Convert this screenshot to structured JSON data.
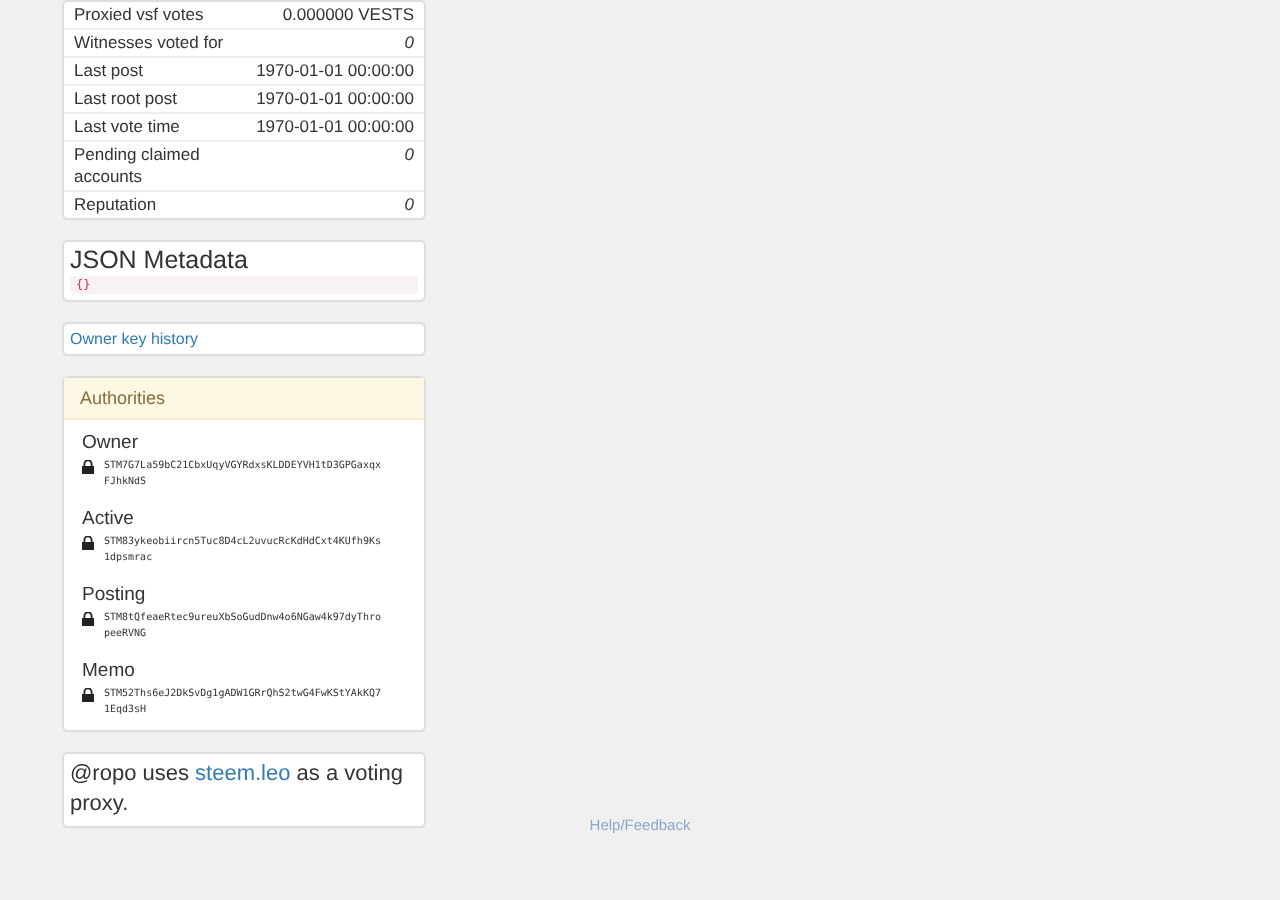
{
  "stats": [
    {
      "label": "Proxied vsf votes",
      "value": "0.000000 VESTS",
      "italic": false
    },
    {
      "label": "Witnesses voted for",
      "value": "0",
      "italic": true
    },
    {
      "label": "Last post",
      "value": "1970-01-01 00:00:00",
      "italic": false
    },
    {
      "label": "Last root post",
      "value": "1970-01-01 00:00:00",
      "italic": false
    },
    {
      "label": "Last vote time",
      "value": "1970-01-01 00:00:00",
      "italic": false
    },
    {
      "label": "Pending claimed accounts",
      "value": "0",
      "italic": true
    },
    {
      "label": "Reputation",
      "value": "0",
      "italic": true
    }
  ],
  "json_metadata": {
    "title": "JSON Metadata",
    "value": "{}"
  },
  "owner_key_history": {
    "label": "Owner key history"
  },
  "authorities": {
    "title": "Authorities",
    "roles": [
      {
        "name": "Owner",
        "key": "STM7G7La59bC21CbxUqyVGYRdxsKLDDEYVH1tD3GPGaxqxFJhkNdS"
      },
      {
        "name": "Active",
        "key": "STM83ykeobiircn5Tuc8D4cL2uvucRcKdHdCxt4KUfh9Ks1dpsmrac"
      },
      {
        "name": "Posting",
        "key": "STM8tQfeaeRtec9ureuXbSoGudDnw4o6NGaw4k97dyThropeeRVNG"
      },
      {
        "name": "Memo",
        "key": "STM52Ths6eJ2DkSvDg1gADW1GRrQhS2twG4FwKStYAkKQ71Eqd3sH"
      }
    ]
  },
  "proxy": {
    "before": "@ropo uses ",
    "link": "steem.leo",
    "after": " as a voting proxy."
  },
  "footer": {
    "link": "Help/Feedback"
  }
}
